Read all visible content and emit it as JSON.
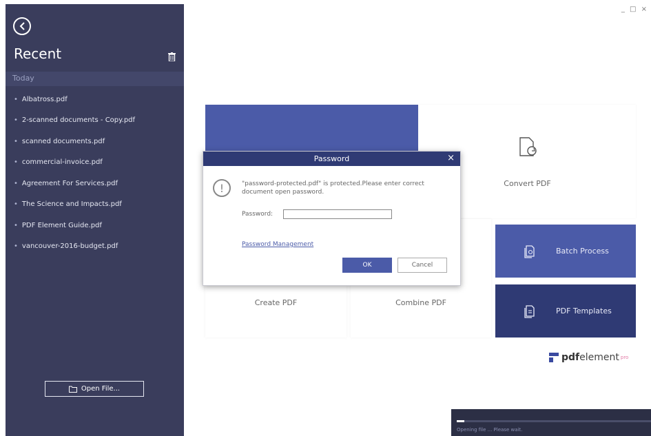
{
  "sidebar": {
    "title": "Recent",
    "section": "Today",
    "files": [
      "Albatross.pdf",
      "2-scanned documents - Copy.pdf",
      "scanned documents.pdf",
      "commercial-invoice.pdf",
      "Agreement For Services.pdf",
      "The Science and Impacts.pdf",
      "PDF Element Guide.pdf",
      "vancouver-2016-budget.pdf"
    ],
    "open_file_label": "Open File..."
  },
  "window_controls": "_ □ ×",
  "tiles": {
    "convert": "Convert PDF",
    "create": "Create PDF",
    "combine": "Combine PDF",
    "batch": "Batch Process",
    "templates": "PDF Templates"
  },
  "brand": {
    "pdf": "pdf",
    "element": "element",
    "pro": "pro"
  },
  "progress": {
    "text": "Opening file ... Please wait.",
    "fraction": 0.04
  },
  "dialog": {
    "title": "Password",
    "close": "×",
    "message": "\"password-protected.pdf\" is protected.Please enter correct document open password.",
    "password_label": "Password:",
    "password_value": "",
    "management_link": "Password Management",
    "ok": "OK",
    "cancel": "Cancel"
  },
  "colors": {
    "sidebar_bg": "#3a3d5c",
    "accent": "#4b5ba8",
    "dark_accent": "#2f3a74"
  }
}
